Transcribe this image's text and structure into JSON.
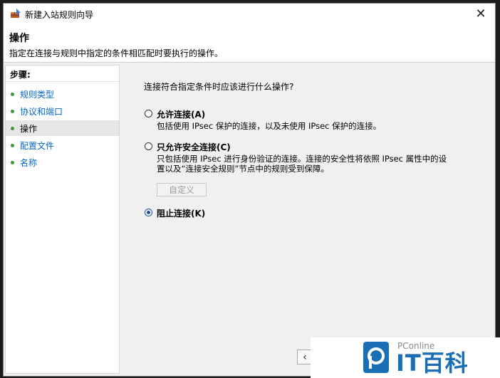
{
  "window": {
    "title": "新建入站规则向导",
    "close_glyph": "✕"
  },
  "header": {
    "title": "操作",
    "description": "指定在连接与规则中指定的条件相匹配时要执行的操作。"
  },
  "sidebar": {
    "steps_label": "步骤:",
    "items": [
      {
        "label": "规则类型",
        "active": false
      },
      {
        "label": "协议和端口",
        "active": false
      },
      {
        "label": "操作",
        "active": true
      },
      {
        "label": "配置文件",
        "active": false
      },
      {
        "label": "名称",
        "active": false
      }
    ]
  },
  "main": {
    "question": "连接符合指定条件时应该进行什么操作?",
    "options": [
      {
        "label": "允许连接(A)",
        "description": [
          "包括使用 IPsec 保护的连接，以及未使用 IPsec 保护的连接。"
        ],
        "selected": false
      },
      {
        "label": "只允许安全连接(C)",
        "description": [
          "只包括使用 IPsec 进行身份验证的连接。连接的安全性将依照 IPsec 属性中的设",
          "置以及“连接安全规则”节点中的规则受到保障。"
        ],
        "selected": false
      },
      {
        "label": "阻止连接(K)",
        "description": [],
        "selected": true
      }
    ],
    "custom_button": "自定义",
    "back_glyph": "‹"
  },
  "watermark": {
    "small_text": "PConline",
    "brand_text": "IT百科"
  },
  "colors": {
    "link": "#0066cc",
    "step_dot": "#3a9a35",
    "brand": "#1a6fb7"
  }
}
